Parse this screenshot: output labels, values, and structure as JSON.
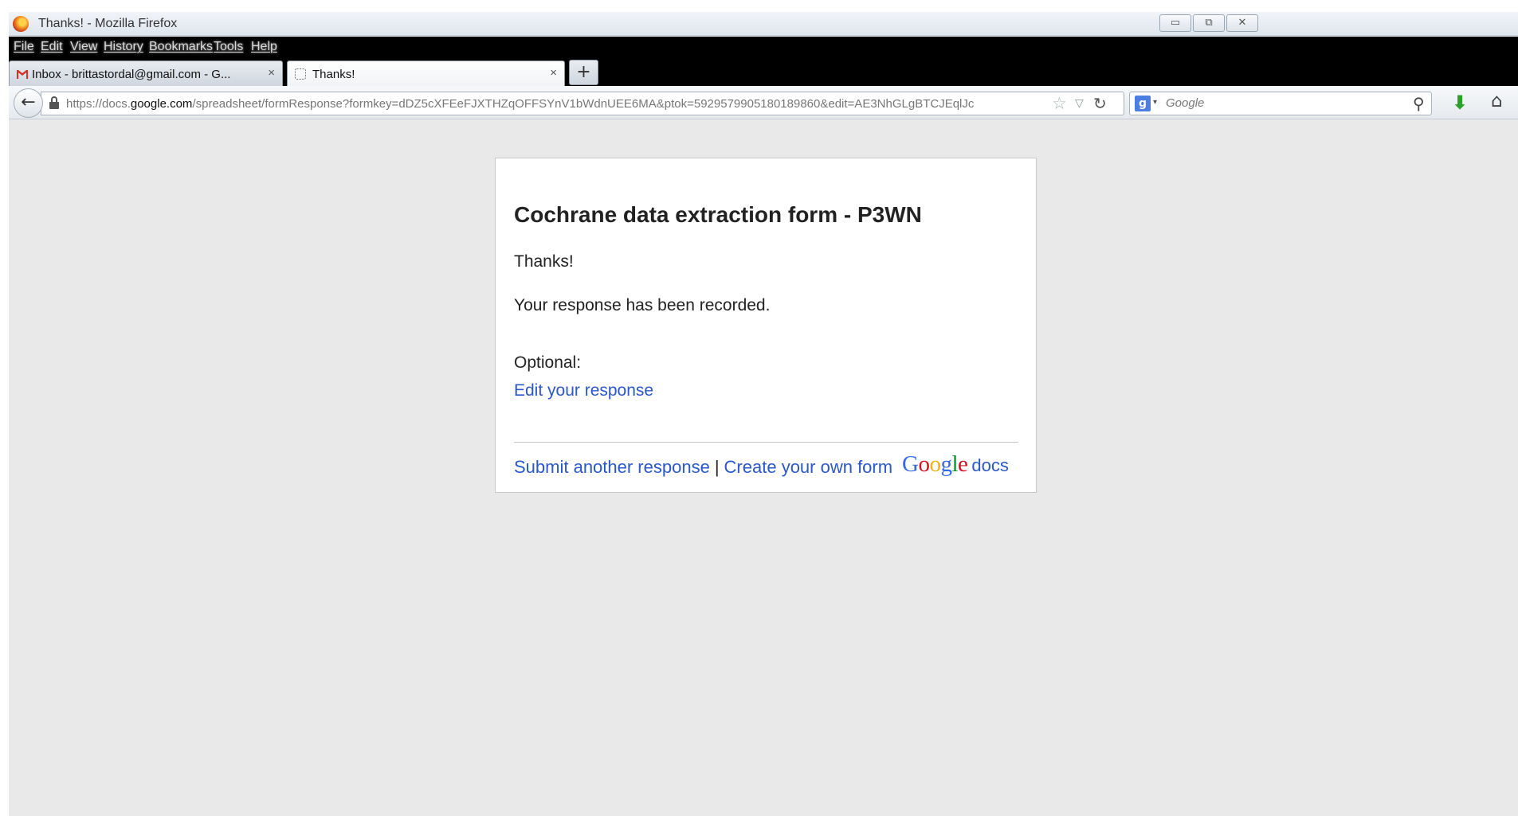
{
  "window": {
    "title": "Thanks! - Mozilla Firefox",
    "controls": {
      "minimize": "▭",
      "restore": "⧉",
      "close": "✕"
    }
  },
  "menubar": {
    "items": [
      "File",
      "Edit",
      "View",
      "History",
      "Bookmarks",
      "Tools",
      "Help"
    ]
  },
  "tabs": [
    {
      "label": "Inbox - brittastordal@gmail.com - G...",
      "icon": "gmail-icon",
      "active": false
    },
    {
      "label": "Thanks!",
      "icon": "blank-page-icon",
      "active": true
    }
  ],
  "tab_close_glyph": "×",
  "new_tab_glyph": "+",
  "navbar": {
    "back_glyph": "←",
    "url_prefix": "https://docs.",
    "url_domain": "google.com",
    "url_suffix": "/spreadsheet/formResponse?formkey=dDZ5cXFEeFJXTHZqOFFSYnV1bWdnUEE6MA&ptok=5929579905180189860&edit=AE3NhGLgBTCJEqlJc",
    "star_glyph": "☆",
    "dropmarker_glyph": "▽",
    "reload_glyph": "↻",
    "search_engine_glyph": "g",
    "search_engine_arrow": "▾",
    "search_placeholder": "Google",
    "search_go_glyph": "⚲",
    "download_glyph": "⬇",
    "home_glyph": "⌂"
  },
  "card": {
    "title": "Cochrane data extraction form - P3WN",
    "thanks": "Thanks!",
    "recorded": "Your response has been recorded.",
    "optional_label": "Optional:",
    "edit_link": "Edit your response",
    "footer": {
      "submit_another": "Submit another response",
      "separator": "|",
      "create_own": "Create your own form",
      "logo_letters": [
        "G",
        "o",
        "o",
        "g",
        "l",
        "e"
      ],
      "logo_colors": [
        "#3369e8",
        "#d50f25",
        "#eeb211",
        "#3369e8",
        "#009925",
        "#d50f25"
      ],
      "docs_word": "docs"
    }
  },
  "colors": {
    "link": "#2a57c9",
    "page_background": "#e9e9e9",
    "menubar_background": "#000000"
  }
}
